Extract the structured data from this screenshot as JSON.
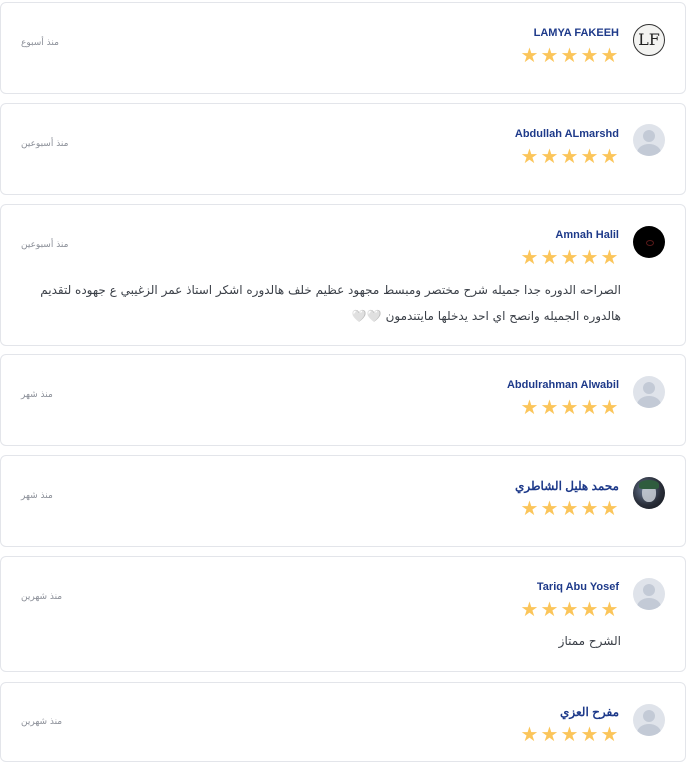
{
  "reviews": [
    {
      "name": "LAMYA FAKEEH",
      "time": "منذ أسبوع",
      "avatar": "monogram",
      "avatar_text": "LF",
      "rating": 5,
      "comment": ""
    },
    {
      "name": "Abdullah ALmarshd",
      "time": "منذ أسبوعين",
      "avatar": "default",
      "rating": 5,
      "comment": ""
    },
    {
      "name": "Amnah Halil",
      "time": "منذ أسبوعين",
      "avatar": "dark",
      "rating": 5,
      "comment": "الصراحه الدوره جدا جميله شرح مختصر ومبسط مجهود عظيم خلف هالدوره اشكر استاذ عمر الزغيبي ع جهوده لتقديم هالدوره الجميله وانصح اي احد يدخلها مايتندمون",
      "comment_suffix": "🤍🤍"
    },
    {
      "name": "Abdulrahman Alwabil",
      "time": "منذ شهر",
      "avatar": "default",
      "rating": 5,
      "comment": ""
    },
    {
      "name": "محمد هليل الشاطري",
      "time": "منذ شهر",
      "avatar": "photo",
      "rating": 5,
      "comment": ""
    },
    {
      "name": "Tariq Abu Yosef",
      "time": "منذ شهرين",
      "avatar": "default",
      "rating": 5,
      "comment": "الشرح ممتاز"
    },
    {
      "name": "مفرح العزي",
      "time": "منذ شهرين",
      "avatar": "default",
      "rating": 5,
      "comment": ""
    }
  ],
  "colors": {
    "name": "#1e3a8a",
    "star": "#fbc55a",
    "time": "#8b8f98",
    "border": "#e3e5ea"
  }
}
